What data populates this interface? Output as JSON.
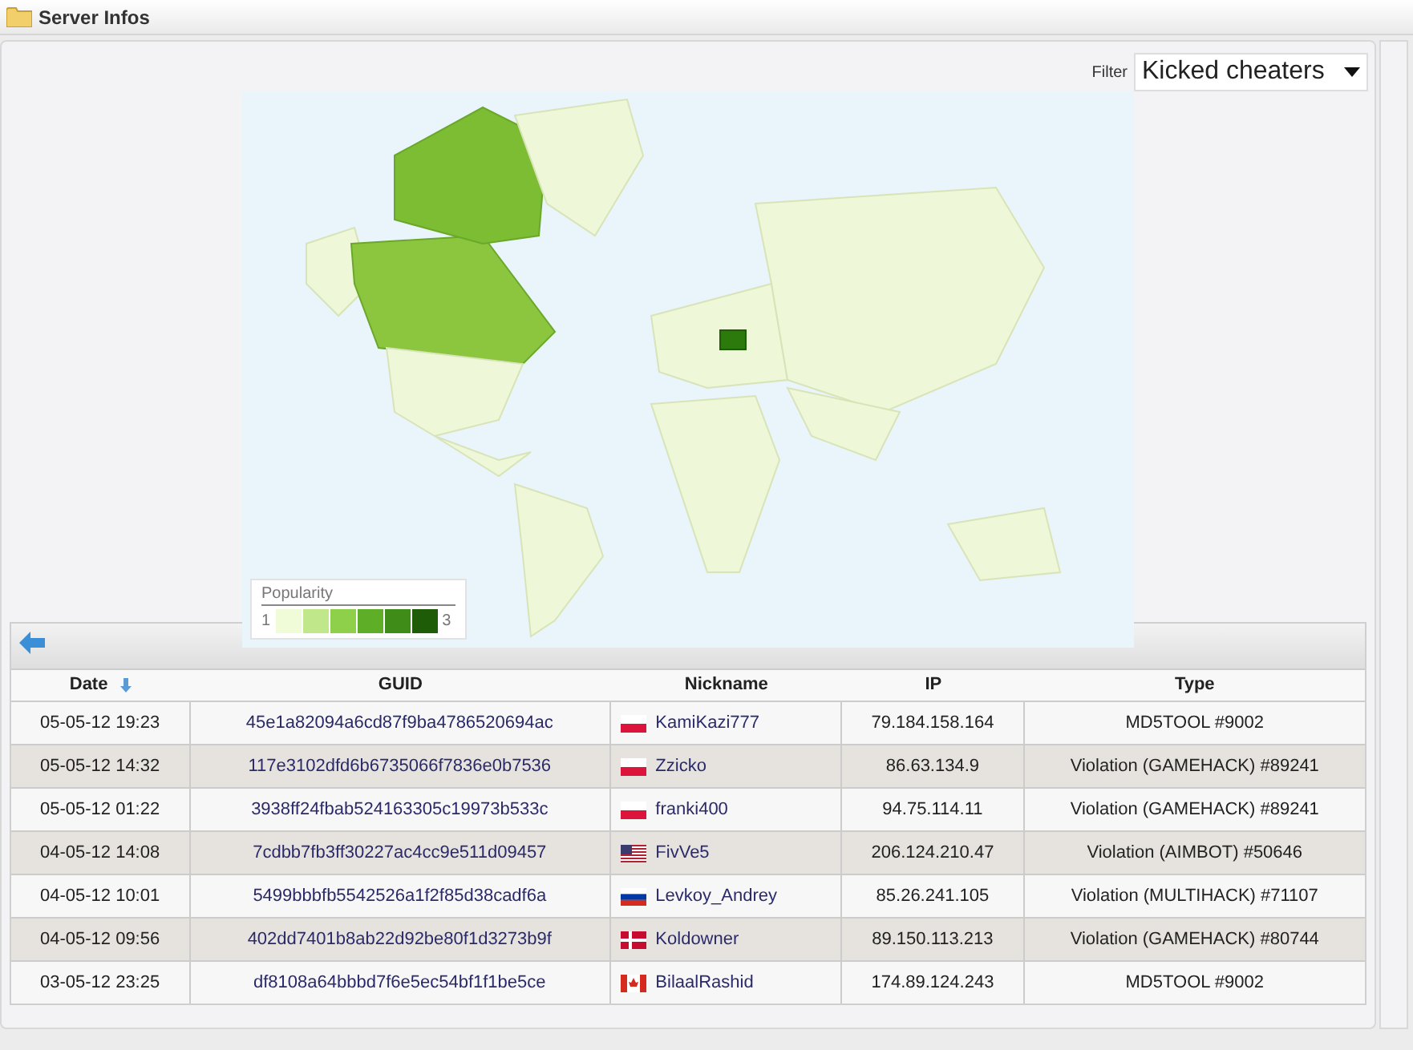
{
  "header": {
    "title": "Server Infos"
  },
  "filter": {
    "label": "Filter",
    "value": "Kicked cheaters"
  },
  "map": {
    "legend": {
      "title": "Popularity",
      "min": "1",
      "max": "3"
    }
  },
  "table": {
    "columns": [
      {
        "label": "Date",
        "sorted": true
      },
      {
        "label": "GUID",
        "sorted": false
      },
      {
        "label": "Nickname",
        "sorted": false
      },
      {
        "label": "IP",
        "sorted": false
      },
      {
        "label": "Type",
        "sorted": false
      }
    ],
    "rows": [
      {
        "date": "05-05-12 19:23",
        "guid": "45e1a82094a6cd87f9ba4786520694ac",
        "kind": "poland",
        "nickname": "KamiKazi777",
        "ip": "79.184.158.164",
        "type": "MD5TOOL #9002"
      },
      {
        "date": "05-05-12 14:32",
        "guid": "117e3102dfd6b6735066f7836e0b7536",
        "kind": "poland",
        "nickname": "Zzicko",
        "ip": "86.63.134.9",
        "type": "Violation (GAMEHACK) #89241"
      },
      {
        "date": "05-05-12 01:22",
        "guid": "3938ff24fbab524163305c19973b533c",
        "kind": "poland",
        "nickname": "franki400",
        "ip": "94.75.114.11",
        "type": "Violation (GAMEHACK) #89241"
      },
      {
        "date": "04-05-12 14:08",
        "guid": "7cdbb7fb3ff30227ac4cc9e511d09457",
        "kind": "usa",
        "nickname": "FivVe5",
        "ip": "206.124.210.47",
        "type": "Violation (AIMBOT) #50646"
      },
      {
        "date": "04-05-12 10:01",
        "guid": "5499bbbfb5542526a1f2f85d38cadf6a",
        "kind": "russia",
        "nickname": "Levkoy_Andrey",
        "ip": "85.26.241.105",
        "type": "Violation (MULTIHACK) #71107"
      },
      {
        "date": "04-05-12 09:56",
        "guid": "402dd7401b8ab22d92be80f1d3273b9f",
        "kind": "denmark",
        "nickname": "Koldowner",
        "ip": "89.150.113.213",
        "type": "Violation (GAMEHACK) #80744"
      },
      {
        "date": "03-05-12 23:25",
        "guid": "df8108a64bbbd7f6e5ec54bf1f1be5ce",
        "kind": "canada",
        "nickname": "BilaalRashid",
        "ip": "174.89.124.243",
        "type": "MD5TOOL #9002"
      }
    ]
  }
}
